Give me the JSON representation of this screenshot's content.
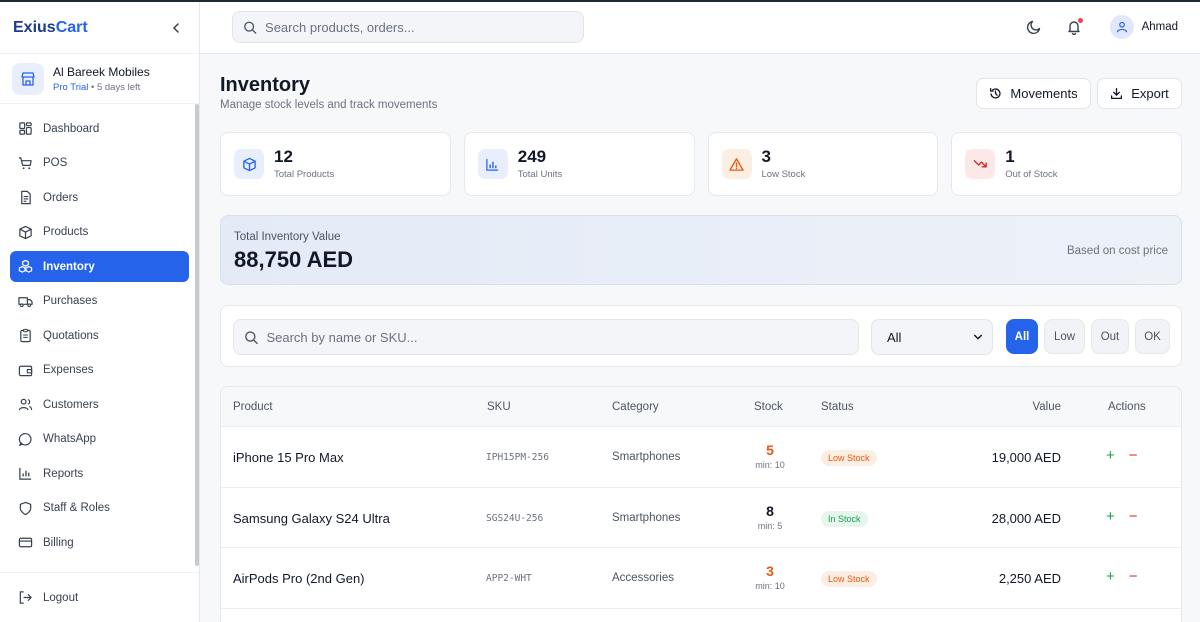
{
  "brand": {
    "name_part1": "Exius",
    "name_part2": "Cart"
  },
  "store": {
    "name": "Al Bareek Mobiles",
    "plan": "Pro Trial",
    "trial_note": "• 5 days left"
  },
  "sidebar": {
    "items": [
      {
        "label": "Dashboard",
        "icon": "dashboard-icon"
      },
      {
        "label": "POS",
        "icon": "cart-icon"
      },
      {
        "label": "Orders",
        "icon": "orders-icon"
      },
      {
        "label": "Products",
        "icon": "box-icon"
      },
      {
        "label": "Inventory",
        "icon": "boxes-icon",
        "active": true
      },
      {
        "label": "Purchases",
        "icon": "truck-icon"
      },
      {
        "label": "Quotations",
        "icon": "clipboard-icon"
      },
      {
        "label": "Expenses",
        "icon": "wallet-icon"
      },
      {
        "label": "Customers",
        "icon": "users-icon"
      },
      {
        "label": "WhatsApp",
        "icon": "chat-icon"
      },
      {
        "label": "Reports",
        "icon": "chart-icon"
      },
      {
        "label": "Staff & Roles",
        "icon": "shield-icon"
      },
      {
        "label": "Billing",
        "icon": "card-icon"
      }
    ],
    "logout_label": "Logout"
  },
  "header": {
    "search_placeholder": "Search products, orders...",
    "user_name": "Ahmad"
  },
  "page": {
    "title": "Inventory",
    "subtitle": "Manage stock levels and track movements",
    "movements_label": "Movements",
    "export_label": "Export"
  },
  "stats": [
    {
      "value": "12",
      "label": "Total Products",
      "icon": "cube-icon",
      "color": "#2563eb",
      "bg": "#e8eefb"
    },
    {
      "value": "249",
      "label": "Total Units",
      "icon": "bar-chart-icon",
      "color": "#2563eb",
      "bg": "#e8eefb"
    },
    {
      "value": "3",
      "label": "Low Stock",
      "icon": "warning-icon",
      "color": "#ea580c",
      "bg": "#fdeee4"
    },
    {
      "value": "1",
      "label": "Out of Stock",
      "icon": "trending-down-icon",
      "color": "#dc2626",
      "bg": "#fde8e8"
    }
  ],
  "inventory_value": {
    "label": "Total Inventory Value",
    "value": "88,750 AED",
    "note": "Based on cost price"
  },
  "filters": {
    "search_placeholder": "Search by name or SKU...",
    "category_selected": "All",
    "chips": [
      "All",
      "Low",
      "Out",
      "OK"
    ],
    "active_chip": "All"
  },
  "table": {
    "headers": {
      "product": "Product",
      "sku": "SKU",
      "category": "Category",
      "stock": "Stock",
      "status": "Status",
      "value": "Value",
      "actions": "Actions"
    },
    "rows": [
      {
        "product": "iPhone 15 Pro Max",
        "sku": "IPH15PM-256",
        "category": "Smartphones",
        "stock": "5",
        "min": "min: 10",
        "status": "Low Stock",
        "value": "19,000 AED",
        "add": "+",
        "remove": "−"
      },
      {
        "product": "Samsung Galaxy S24 Ultra",
        "sku": "SGS24U-256",
        "category": "Smartphones",
        "stock": "8",
        "min": "min: 5",
        "status": "In Stock",
        "value": "28,000 AED",
        "add": "+",
        "remove": "−"
      },
      {
        "product": "AirPods Pro (2nd Gen)",
        "sku": "APP2-WHT",
        "category": "Accessories",
        "stock": "3",
        "min": "min: 10",
        "status": "Low Stock",
        "value": "2,250 AED",
        "add": "+",
        "remove": "−"
      }
    ]
  },
  "colors": {
    "primary": "#2563eb",
    "low_stock": "#ea580c",
    "low_stock_bg": "#fdeee4",
    "in_stock": "#16a34a",
    "in_stock_bg": "#e6f6ec",
    "danger": "#dc2626"
  }
}
